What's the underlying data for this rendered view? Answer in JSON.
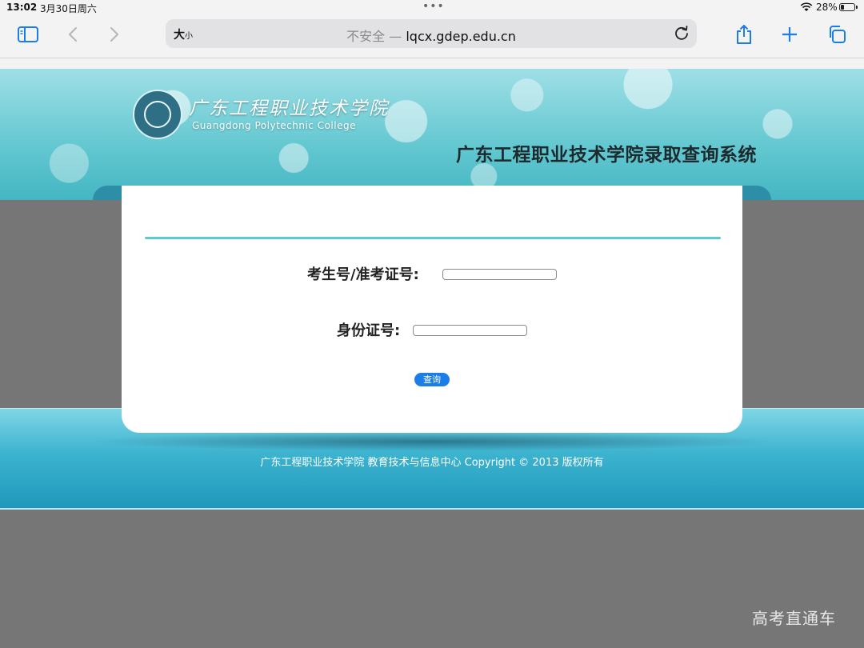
{
  "status_bar": {
    "time": "13:02",
    "date": "3月30日周六",
    "battery_percent": "28%",
    "battery_level": 0.28
  },
  "browser": {
    "text_size_label": "大",
    "text_size_label_small": "小",
    "security_label": "不安全",
    "separator": "—",
    "domain": "lqcx.gdep.edu.cn",
    "icons": [
      "sidebar-icon",
      "back-icon",
      "forward-icon",
      "reload-icon",
      "share-icon",
      "plus-icon",
      "tabs-icon"
    ]
  },
  "header": {
    "college_name_cn": "广东工程职业技术学院",
    "college_name_en": "Guangdong Polytechnic College",
    "system_title": "广东工程职业技术学院录取查询系统"
  },
  "form": {
    "exam_number_label": "考生号/准考证号:",
    "exam_number_value": "",
    "id_number_label": "身份证号:",
    "id_number_value": "",
    "submit_label": "查询"
  },
  "footer": {
    "copyright": "广东工程职业技术学院 教育技术与信息中心 Copyright © 2013 版权所有"
  },
  "watermark": "高考直通车",
  "colors": {
    "accent_rule": "#5fc9cf",
    "button": "#1a7de8",
    "header_teal": "#62c7d0",
    "background_gray": "#767676"
  }
}
